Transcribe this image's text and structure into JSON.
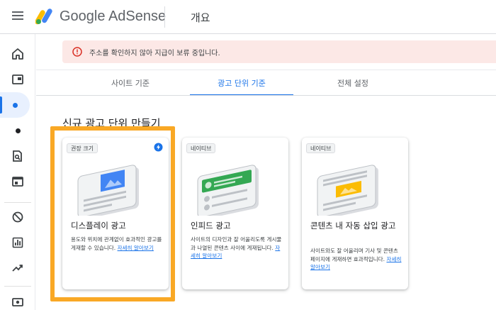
{
  "header": {
    "product": "Google AdSense",
    "title": "개요"
  },
  "rail": {
    "icons": [
      "home-icon",
      "ads-icon",
      "dot-icon",
      "dot-icon",
      "search-page-icon",
      "browser-icon",
      "block-icon",
      "bar-chart-icon",
      "trending-icon",
      "payments-icon"
    ]
  },
  "alert": {
    "message": "주소를 확인하지 않아 지급이 보류 중입니다."
  },
  "tabs": [
    {
      "label": "사이트 기준"
    },
    {
      "label": "광고 단위 기준"
    },
    {
      "label": "전체 설정"
    }
  ],
  "section": {
    "title": "신규 광고 단위 만들기"
  },
  "cards": [
    {
      "badge": "권장 크기",
      "title": "디스플레이 광고",
      "desc": "용도와 위치에 관계없이 효과적인 광고를 게재할 수 있습니다.",
      "link": "자세히 알아보기"
    },
    {
      "badge": "네이티브",
      "title": "인피드 광고",
      "desc": "사이트의 디자인과 잘 어울리도록 게시물과 나열된 콘텐츠 사이에 게재됩니다.",
      "link": "자세히 알아보기"
    },
    {
      "badge": "네이티브",
      "title": "콘텐츠 내 자동 삽입 광고",
      "desc": "사이트와도 잘 어울리며 기사 및 콘텐츠 페이지에 게재하면 효과적입니다.",
      "link": "자세히 알아보기"
    }
  ],
  "colors": {
    "accent": "#1a73e8",
    "alert_bg": "#fce8e6",
    "alert_icon": "#d93025",
    "highlight": "#f9a825",
    "card1_ad": "#4285f4",
    "card2_ad": "#34a853",
    "card3_ad": "#fbbc04"
  }
}
